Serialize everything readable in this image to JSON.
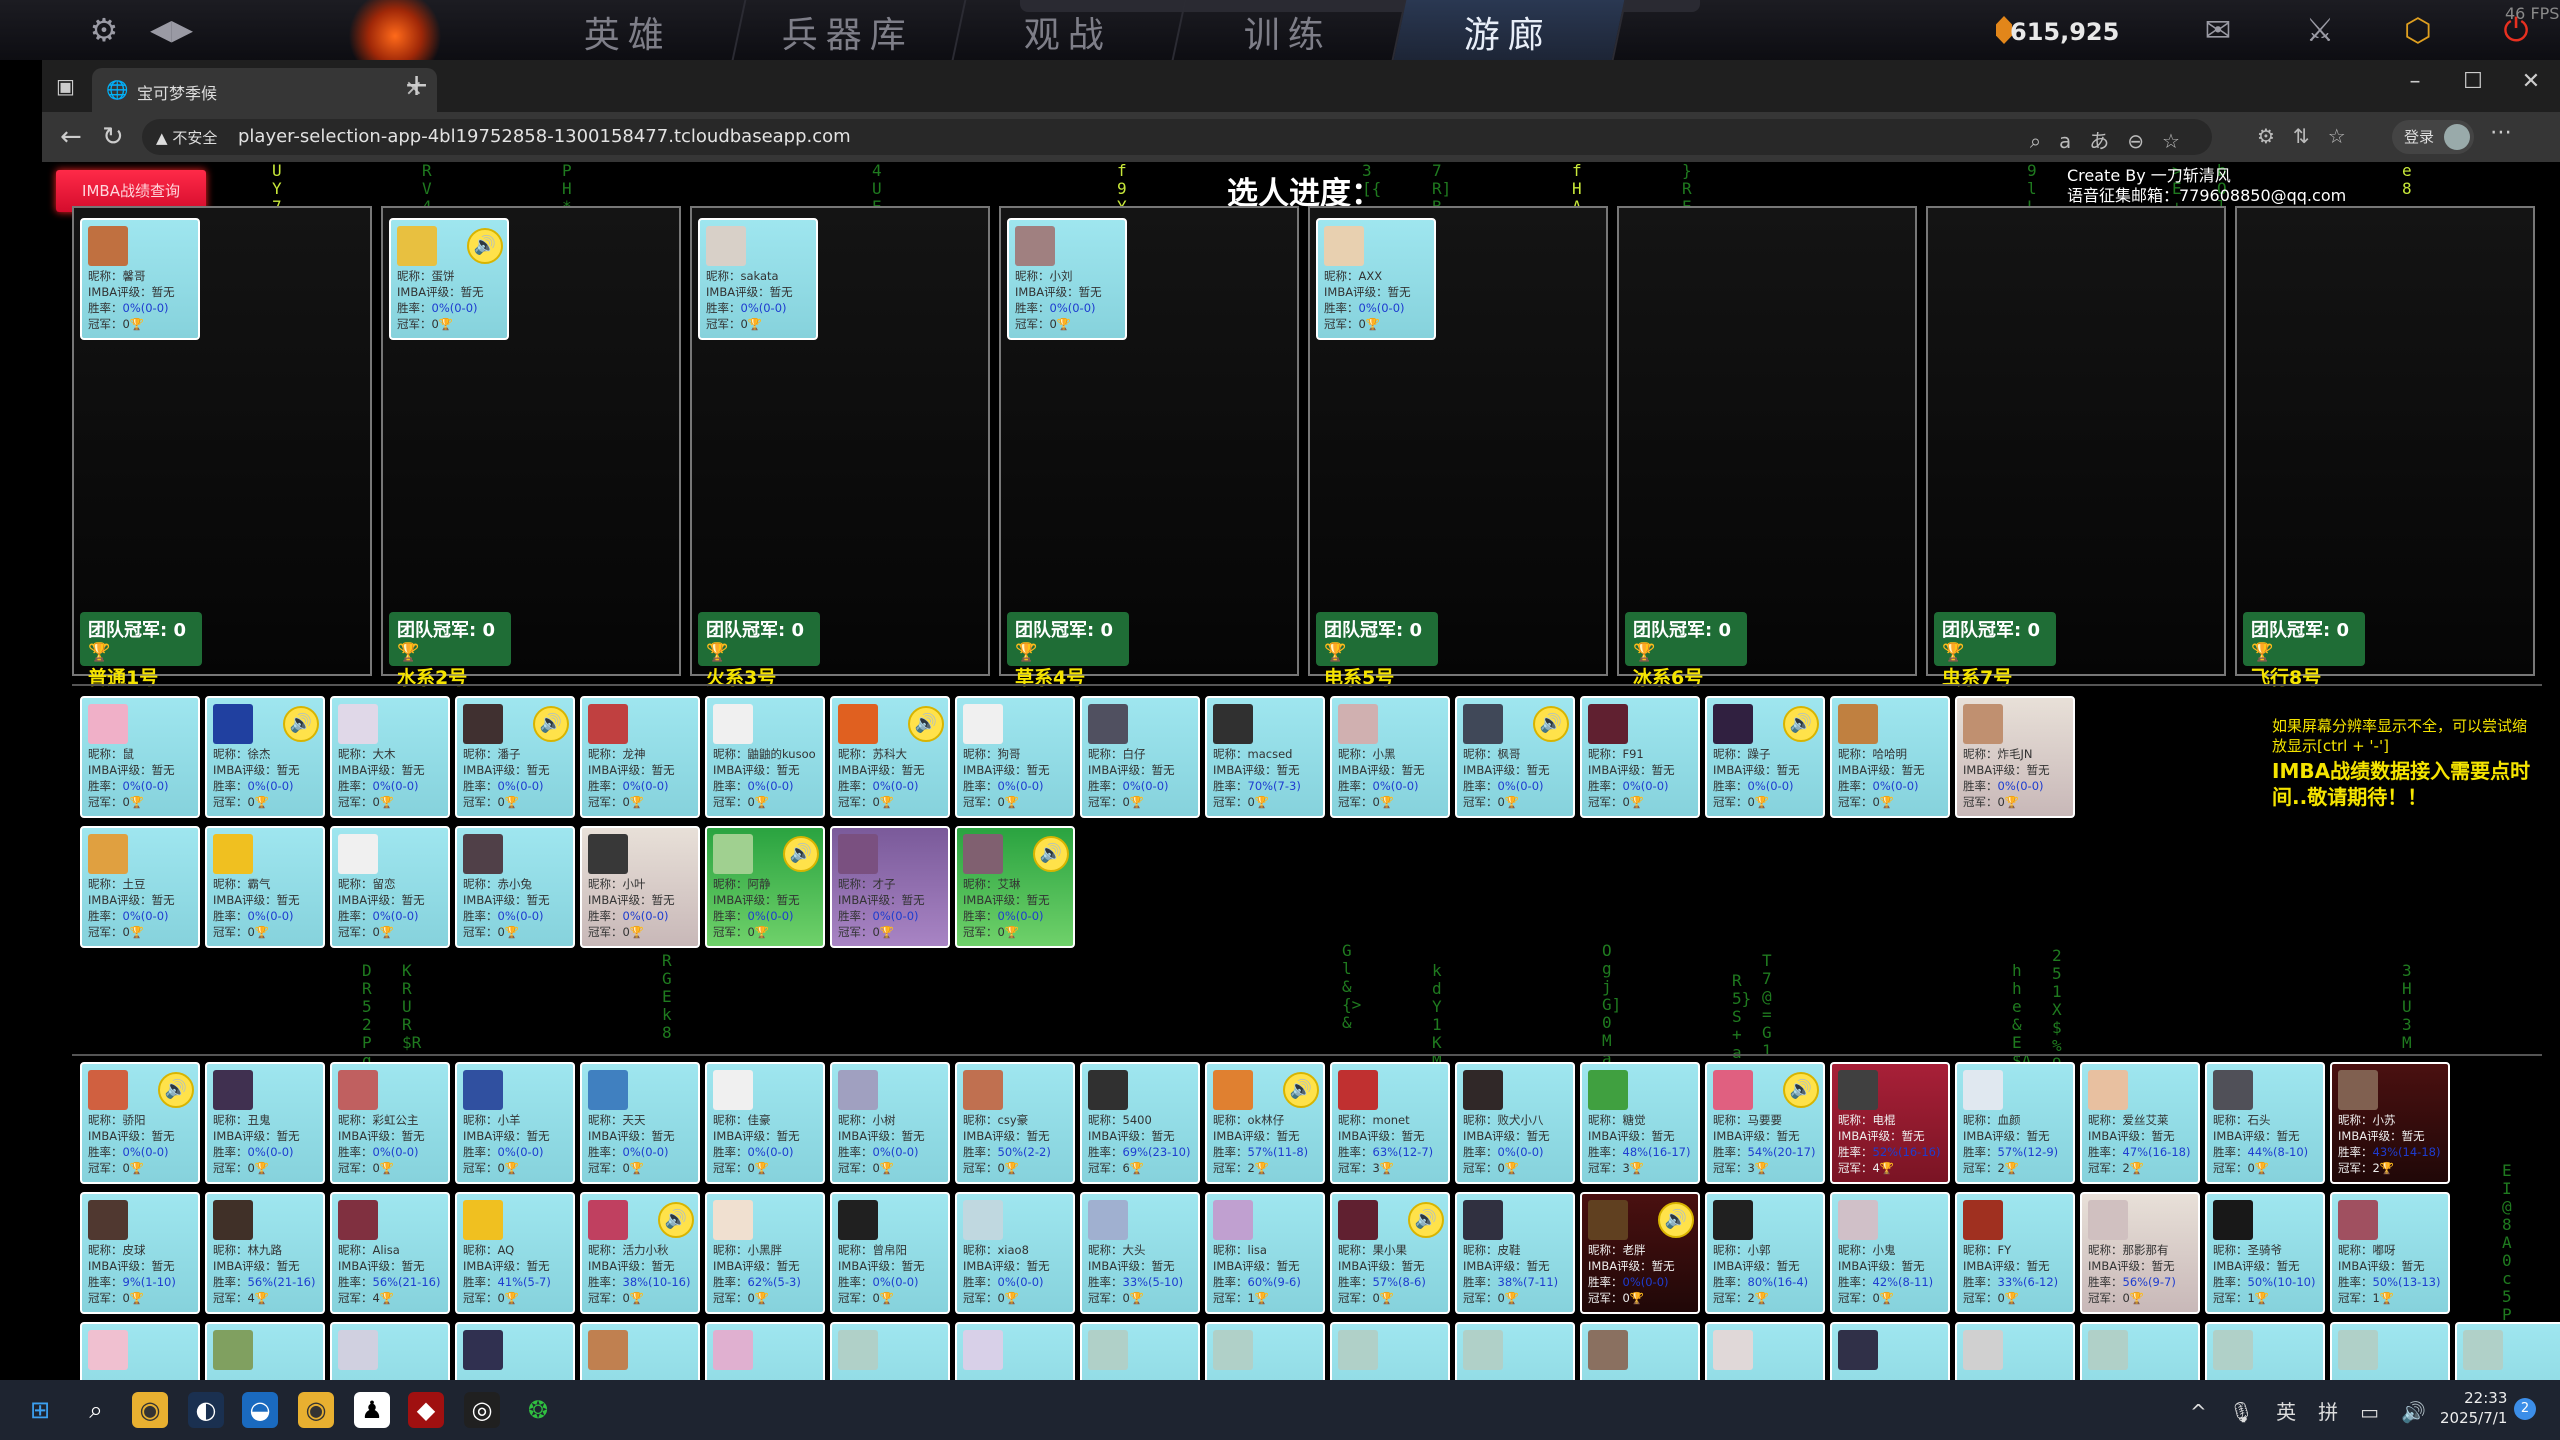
{
  "game": {
    "tabs": [
      {
        "label": "英雄",
        "active": false
      },
      {
        "label": "兵器库",
        "active": false
      },
      {
        "label": "观战",
        "active": false
      },
      {
        "label": "训练",
        "active": false
      },
      {
        "label": "游廊",
        "active": true
      }
    ],
    "gold": "615,925",
    "fps": "46 FPS",
    "icons": [
      "gear-icon",
      "back-icon",
      "mail-icon",
      "armory-icon",
      "clan-icon",
      "power-icon"
    ]
  },
  "browser": {
    "tab_title": "宝可梦季候",
    "insecure_label": "不安全",
    "url": "player-selection-app-4bl19752858-1300158477.tcloudbaseapp.com",
    "login_label": "登录"
  },
  "page": {
    "imba_button": "IMBA战绩查询",
    "progress_title": "选人进度：",
    "credit_line1": "Create By 一刀斩清风",
    "credit_line2": "语音征集邮箱：779608850@qq.com",
    "notice_small": "如果屏幕分辨率显示不全，可以尝试缩放显示[ctrl + '-']",
    "notice_big": "IMBA战绩数据接入需要点时间..敬请期待！！",
    "labels": {
      "nick": "昵称：",
      "rating": "IMBA评级：",
      "winrate": "胜率：",
      "champ": "冠军："
    },
    "teams": [
      {
        "cup_label": "团队冠军: 0",
        "name": "普通1号"
      },
      {
        "cup_label": "团队冠军: 0",
        "name": "水系2号"
      },
      {
        "cup_label": "团队冠军: 0",
        "name": "火系3号"
      },
      {
        "cup_label": "团队冠军: 0",
        "name": "草系4号"
      },
      {
        "cup_label": "团队冠军: 0",
        "name": "电系5号"
      },
      {
        "cup_label": "团队冠军: 0",
        "name": "冰系6号"
      },
      {
        "cup_label": "团队冠军: 0",
        "name": "虫系7号"
      },
      {
        "cup_label": "团队冠军: 0",
        "name": "飞行8号"
      }
    ],
    "team_members": [
      [
        {
          "nick": "馨哥",
          "rating": "暂无",
          "winrate": "0%(0-0)",
          "champ": "0",
          "speaker": false,
          "color": "#c07040"
        }
      ],
      [
        {
          "nick": "蛋饼",
          "rating": "暂无",
          "winrate": "0%(0-0)",
          "champ": "0",
          "speaker": true,
          "color": "#e8c040"
        }
      ],
      [
        {
          "nick": "sakata",
          "rating": "暂无",
          "winrate": "0%(0-0)",
          "champ": "0",
          "speaker": false,
          "color": "#d8d0c8"
        }
      ],
      [
        {
          "nick": "小刘",
          "rating": "暂无",
          "winrate": "0%(0-0)",
          "champ": "0",
          "speaker": false,
          "color": "#a08080"
        }
      ],
      [
        {
          "nick": "AXX",
          "rating": "暂无",
          "winrate": "0%(0-0)",
          "champ": "0",
          "speaker": false,
          "color": "#e8d0b0"
        }
      ],
      [],
      [],
      []
    ],
    "pool_a": [
      {
        "nick": "鼠",
        "rating": "暂无",
        "winrate": "0%(0-0)",
        "champ": "0",
        "speaker": false,
        "color": "#f0b0c8",
        "style": ""
      },
      {
        "nick": "徐杰",
        "rating": "暂无",
        "winrate": "0%(0-0)",
        "champ": "0",
        "speaker": true,
        "color": "#2040a0",
        "style": ""
      },
      {
        "nick": "大木",
        "rating": "暂无",
        "winrate": "0%(0-0)",
        "champ": "0",
        "speaker": false,
        "color": "#e0d8e8",
        "style": ""
      },
      {
        "nick": "潘子",
        "rating": "暂无",
        "winrate": "0%(0-0)",
        "champ": "0",
        "speaker": true,
        "color": "#403030",
        "style": ""
      },
      {
        "nick": "龙神",
        "rating": "暂无",
        "winrate": "0%(0-0)",
        "champ": "0",
        "speaker": false,
        "color": "#c04040",
        "style": ""
      },
      {
        "nick": "鼬鼬的kusoo",
        "rating": "暂无",
        "winrate": "0%(0-0)",
        "champ": "0",
        "speaker": false,
        "color": "#f0f0f0",
        "style": ""
      },
      {
        "nick": "苏科大",
        "rating": "暂无",
        "winrate": "0%(0-0)",
        "champ": "0",
        "speaker": true,
        "color": "#e06020",
        "style": ""
      },
      {
        "nick": "狗哥",
        "rating": "暂无",
        "winrate": "0%(0-0)",
        "champ": "0",
        "speaker": false,
        "color": "#f0f0f0",
        "style": ""
      },
      {
        "nick": "白仔",
        "rating": "暂无",
        "winrate": "0%(0-0)",
        "champ": "0",
        "speaker": false,
        "color": "#505060",
        "style": ""
      },
      {
        "nick": "macsed",
        "rating": "暂无",
        "winrate": "70%(7-3)",
        "champ": "0",
        "speaker": false,
        "color": "#303030",
        "style": ""
      },
      {
        "nick": "小黑",
        "rating": "暂无",
        "winrate": "0%(0-0)",
        "champ": "0",
        "speaker": false,
        "color": "#d0b0b0",
        "style": ""
      },
      {
        "nick": "枫哥",
        "rating": "暂无",
        "winrate": "0%(0-0)",
        "champ": "0",
        "speaker": true,
        "color": "#404858",
        "style": ""
      },
      {
        "nick": "F91",
        "rating": "暂无",
        "winrate": "0%(0-0)",
        "champ": "0",
        "speaker": false,
        "color": "#602030",
        "style": ""
      },
      {
        "nick": "躁子",
        "rating": "暂无",
        "winrate": "0%(0-0)",
        "champ": "0",
        "speaker": true,
        "color": "#302040",
        "style": ""
      },
      {
        "nick": "哈哈明",
        "rating": "暂无",
        "winrate": "0%(0-0)",
        "champ": "0",
        "speaker": false,
        "color": "#c08040",
        "style": ""
      },
      {
        "nick": "炸毛JN",
        "rating": "暂无",
        "winrate": "0%(0-0)",
        "champ": "0",
        "speaker": false,
        "color": "#c09070",
        "style": "gold"
      },
      {
        "nick": "土豆",
        "rating": "暂无",
        "winrate": "0%(0-0)",
        "champ": "0",
        "speaker": false,
        "color": "#e0a040",
        "style": ""
      },
      {
        "nick": "霸气",
        "rating": "暂无",
        "winrate": "0%(0-0)",
        "champ": "0",
        "speaker": false,
        "color": "#f0c020",
        "style": ""
      },
      {
        "nick": "留恋",
        "rating": "暂无",
        "winrate": "0%(0-0)",
        "champ": "0",
        "speaker": false,
        "color": "#f0f0f0",
        "style": ""
      },
      {
        "nick": "赤小兔",
        "rating": "暂无",
        "winrate": "0%(0-0)",
        "champ": "0",
        "speaker": false,
        "color": "#504048",
        "style": ""
      },
      {
        "nick": "小叶",
        "rating": "暂无",
        "winrate": "0%(0-0)",
        "champ": "0",
        "speaker": false,
        "color": "#383838",
        "style": "gold"
      },
      {
        "nick": "阿静",
        "rating": "暂无",
        "winrate": "0%(0-0)",
        "champ": "0",
        "speaker": true,
        "color": "#a0d090",
        "style": "green"
      },
      {
        "nick": "才子",
        "rating": "暂无",
        "winrate": "0%(0-0)",
        "champ": "0",
        "speaker": false,
        "color": "#7a5080",
        "style": "purple"
      },
      {
        "nick": "艾琳",
        "rating": "暂无",
        "winrate": "0%(0-0)",
        "champ": "0",
        "speaker": true,
        "color": "#806070",
        "style": "green"
      }
    ],
    "pool_b": [
      {
        "nick": "骄阳",
        "rating": "暂无",
        "winrate": "0%(0-0)",
        "champ": "0",
        "speaker": true,
        "color": "#d06040",
        "style": ""
      },
      {
        "nick": "丑鬼",
        "rating": "暂无",
        "winrate": "0%(0-0)",
        "champ": "0",
        "speaker": false,
        "color": "#403050",
        "style": ""
      },
      {
        "nick": "彩虹公主",
        "rating": "暂无",
        "winrate": "0%(0-0)",
        "champ": "0",
        "speaker": false,
        "color": "#c06060",
        "style": ""
      },
      {
        "nick": "小羊",
        "rating": "暂无",
        "winrate": "0%(0-0)",
        "champ": "0",
        "speaker": false,
        "color": "#3050a0",
        "style": ""
      },
      {
        "nick": "天天",
        "rating": "暂无",
        "winrate": "0%(0-0)",
        "champ": "0",
        "speaker": false,
        "color": "#4080c0",
        "style": ""
      },
      {
        "nick": "佳豪",
        "rating": "暂无",
        "winrate": "0%(0-0)",
        "champ": "0",
        "speaker": false,
        "color": "#f0f0f0",
        "style": ""
      },
      {
        "nick": "小树",
        "rating": "暂无",
        "winrate": "0%(0-0)",
        "champ": "0",
        "speaker": false,
        "color": "#a0a0c0",
        "style": ""
      },
      {
        "nick": "csy豪",
        "rating": "暂无",
        "winrate": "50%(2-2)",
        "champ": "0",
        "speaker": false,
        "color": "#c07050",
        "style": ""
      },
      {
        "nick": "5400",
        "rating": "暂无",
        "winrate": "69%(23-10)",
        "champ": "6",
        "speaker": false,
        "color": "#303030",
        "style": ""
      },
      {
        "nick": "ok林仔",
        "rating": "暂无",
        "winrate": "57%(11-8)",
        "champ": "2",
        "speaker": true,
        "color": "#e08030",
        "style": ""
      },
      {
        "nick": "monet",
        "rating": "暂无",
        "winrate": "63%(12-7)",
        "champ": "3",
        "speaker": false,
        "color": "#c03030",
        "style": ""
      },
      {
        "nick": "败犬小八",
        "rating": "暂无",
        "winrate": "0%(0-0)",
        "champ": "0",
        "speaker": false,
        "color": "#302828",
        "style": ""
      },
      {
        "nick": "糖觉",
        "rating": "暂无",
        "winrate": "48%(16-17)",
        "champ": "3",
        "speaker": false,
        "color": "#40a040",
        "style": ""
      },
      {
        "nick": "马要要",
        "rating": "暂无",
        "winrate": "54%(20-17)",
        "champ": "3",
        "speaker": true,
        "color": "#e06080",
        "style": ""
      },
      {
        "nick": "电棍",
        "rating": "暂无",
        "winrate": "52%(16-16)",
        "champ": "4",
        "speaker": false,
        "color": "#404040",
        "style": "red"
      },
      {
        "nick": "血颜",
        "rating": "暂无",
        "winrate": "57%(12-9)",
        "champ": "2",
        "speaker": false,
        "color": "#e0e8f0",
        "style": ""
      },
      {
        "nick": "爱丝艾莱",
        "rating": "暂无",
        "winrate": "47%(16-18)",
        "champ": "2",
        "speaker": false,
        "color": "#e8c0a0",
        "style": ""
      },
      {
        "nick": "石头",
        "rating": "暂无",
        "winrate": "44%(8-10)",
        "champ": "0",
        "speaker": false,
        "color": "#505058",
        "style": ""
      },
      {
        "nick": "小苏",
        "rating": "暂无",
        "winrate": "43%(14-18)",
        "champ": "2",
        "speaker": false,
        "color": "#806050",
        "style": "dark"
      },
      {
        "nick": "皮球",
        "rating": "暂无",
        "winrate": "9%(1-10)",
        "champ": "0",
        "speaker": false,
        "color": "#503830",
        "style": ""
      },
      {
        "nick": "林九路",
        "rating": "暂无",
        "winrate": "56%(21-16)",
        "champ": "4",
        "speaker": false,
        "color": "#403028",
        "style": ""
      },
      {
        "nick": "Alisa",
        "rating": "暂无",
        "winrate": "56%(21-16)",
        "champ": "4",
        "speaker": false,
        "color": "#803040",
        "style": ""
      },
      {
        "nick": "AQ",
        "rating": "暂无",
        "winrate": "41%(5-7)",
        "champ": "0",
        "speaker": false,
        "color": "#f0c020",
        "style": ""
      },
      {
        "nick": "活力小秋",
        "rating": "暂无",
        "winrate": "38%(10-16)",
        "champ": "0",
        "speaker": true,
        "color": "#c04060",
        "style": ""
      },
      {
        "nick": "小黑胖",
        "rating": "暂无",
        "winrate": "62%(5-3)",
        "champ": "0",
        "speaker": false,
        "color": "#f0e0d0",
        "style": ""
      },
      {
        "nick": "曾帛阳",
        "rating": "暂无",
        "winrate": "0%(0-0)",
        "champ": "0",
        "speaker": false,
        "color": "#202020",
        "style": ""
      },
      {
        "nick": "xiao8",
        "rating": "暂无",
        "winrate": "0%(0-0)",
        "champ": "0",
        "speaker": false,
        "color": "#c0d8e0",
        "style": ""
      },
      {
        "nick": "大头",
        "rating": "暂无",
        "winrate": "33%(5-10)",
        "champ": "0",
        "speaker": false,
        "color": "#a0b0d0",
        "style": ""
      },
      {
        "nick": "lisa",
        "rating": "暂无",
        "winrate": "60%(9-6)",
        "champ": "1",
        "speaker": false,
        "color": "#c0a0d0",
        "style": ""
      },
      {
        "nick": "果小果",
        "rating": "暂无",
        "winrate": "57%(8-6)",
        "champ": "0",
        "speaker": true,
        "color": "#602030",
        "style": ""
      },
      {
        "nick": "皮鞋",
        "rating": "暂无",
        "winrate": "38%(7-11)",
        "champ": "0",
        "speaker": false,
        "color": "#303040",
        "style": ""
      },
      {
        "nick": "老胖",
        "rating": "暂无",
        "winrate": "0%(0-0)",
        "champ": "0",
        "speaker": true,
        "color": "#604020",
        "style": "dark"
      },
      {
        "nick": "小郭",
        "rating": "暂无",
        "winrate": "80%(16-4)",
        "champ": "2",
        "speaker": false,
        "color": "#202020",
        "style": ""
      },
      {
        "nick": "小鬼",
        "rating": "暂无",
        "winrate": "42%(8-11)",
        "champ": "0",
        "speaker": false,
        "color": "#d0c0c8",
        "style": ""
      },
      {
        "nick": "FY",
        "rating": "暂无",
        "winrate": "33%(6-12)",
        "champ": "0",
        "speaker": false,
        "color": "#a03020",
        "style": ""
      },
      {
        "nick": "那影那有",
        "rating": "暂无",
        "winrate": "56%(9-7)",
        "champ": "0",
        "speaker": false,
        "color": "#d0c0c0",
        "style": "gold"
      },
      {
        "nick": "圣骑爷",
        "rating": "暂无",
        "winrate": "50%(10-10)",
        "champ": "1",
        "speaker": false,
        "color": "#181818",
        "style": ""
      },
      {
        "nick": "嘟呀",
        "rating": "暂无",
        "winrate": "50%(13-13)",
        "champ": "1",
        "speaker": false,
        "color": "#a05060",
        "style": ""
      }
    ],
    "pool_b_partial_colors": [
      "#f0c0d0",
      "#80a060",
      "#d0d0e0",
      "#303050",
      "#c08050",
      "#e0b0d0",
      "#b0d0c8",
      "#d8d0e8",
      "#b0d0c8",
      "#b0d0c8",
      "#b0d0c8",
      "#b0d0c8",
      "#8a7060",
      "#e0d8d8",
      "#303048",
      "#d0d0d0",
      "#b0d0c8",
      "#b0d0c8",
      "#b0d0c8",
      "#b0d0c8"
    ]
  },
  "taskbar": {
    "time": "22:33",
    "date": "2025/7/1",
    "ime1": "英",
    "ime2": "拼",
    "notify_count": "2"
  }
}
